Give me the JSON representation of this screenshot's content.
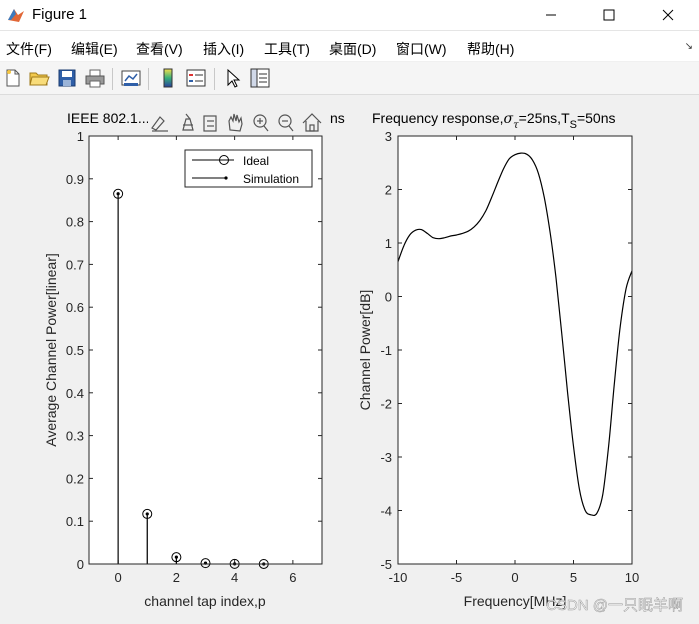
{
  "window": {
    "title": "Figure 1"
  },
  "menu": [
    "文件(F)",
    "编辑(E)",
    "查看(V)",
    "插入(I)",
    "工具(T)",
    "桌面(D)",
    "窗口(W)",
    "帮助(H)"
  ],
  "toolbar": [
    "new-file-icon",
    "open-folder-icon",
    "save-icon",
    "print-icon",
    "link-plot-icon",
    "colorbar-icon",
    "legend-icon",
    "pointer-icon",
    "property-inspector-icon"
  ],
  "axes_toolbar": [
    "edit-icon",
    "brush-icon",
    "data-tips-icon",
    "pan-icon",
    "zoom-in-icon",
    "zoom-out-icon",
    "home-icon"
  ],
  "watermark": "CSDN @一只眠羊啊",
  "chart_data": [
    {
      "type": "stem",
      "title": "IEEE 802.1...ns",
      "xlabel": "channel tap index,p",
      "ylabel": "Average Channel Power[linear]",
      "xlim": [
        -1,
        7
      ],
      "ylim": [
        0,
        1
      ],
      "xticks": [
        "0",
        "2",
        "4",
        "6"
      ],
      "yticks": [
        "0",
        "0.1",
        "0.2",
        "0.3",
        "0.4",
        "0.5",
        "0.6",
        "0.7",
        "0.8",
        "0.9",
        "1"
      ],
      "legend": {
        "position": "top-right",
        "entries": [
          "Ideal",
          "Simulation"
        ]
      },
      "series": [
        {
          "name": "Ideal",
          "marker": "circle",
          "x": [
            0,
            1,
            2,
            3,
            4,
            5
          ],
          "y": [
            0.865,
            0.117,
            0.016,
            0.002,
            0.0003,
            4e-05
          ]
        },
        {
          "name": "Simulation",
          "marker": "dot",
          "x": [
            0,
            1,
            2,
            3,
            4,
            5
          ],
          "y": [
            0.865,
            0.117,
            0.016,
            0.002,
            0.0003,
            4e-05
          ]
        }
      ]
    },
    {
      "type": "line",
      "title_parts": {
        "main": "Frequency response,",
        "sigma": "σ",
        "tau": "τ",
        "mid": "=25ns,T",
        "sub": "S",
        "tail": "=50ns"
      },
      "xlabel": "Frequency[MHz]",
      "ylabel": "Channel Power[dB]",
      "xlim": [
        -10,
        10
      ],
      "ylim": [
        -5,
        3
      ],
      "xticks": [
        "-10",
        "-5",
        "0",
        "5",
        "10"
      ],
      "yticks": [
        "-5",
        "-4",
        "-3",
        "-2",
        "-1",
        "0",
        "1",
        "2",
        "3"
      ],
      "series": [
        {
          "x": [
            -10,
            -9.5,
            -9,
            -8.5,
            -8,
            -7.5,
            -7,
            -6.5,
            -6,
            -5.5,
            -5,
            -4.5,
            -4,
            -3.5,
            -3,
            -2.5,
            -2,
            -1.5,
            -1,
            -0.5,
            0,
            0.5,
            1,
            1.5,
            2,
            2.5,
            3,
            3.5,
            4,
            4.5,
            5,
            5.5,
            6,
            6.5,
            7,
            7.5,
            8,
            8.5,
            9,
            9.5,
            10
          ],
          "y": [
            0.65,
            0.95,
            1.15,
            1.24,
            1.25,
            1.18,
            1.1,
            1.08,
            1.1,
            1.13,
            1.15,
            1.18,
            1.22,
            1.3,
            1.42,
            1.6,
            1.85,
            2.12,
            2.38,
            2.57,
            2.65,
            2.68,
            2.66,
            2.55,
            2.3,
            1.85,
            1.2,
            0.35,
            -0.7,
            -1.8,
            -2.8,
            -3.6,
            -4.0,
            -4.08,
            -4.05,
            -3.7,
            -2.8,
            -1.6,
            -0.55,
            0.15,
            0.48
          ]
        }
      ]
    }
  ]
}
